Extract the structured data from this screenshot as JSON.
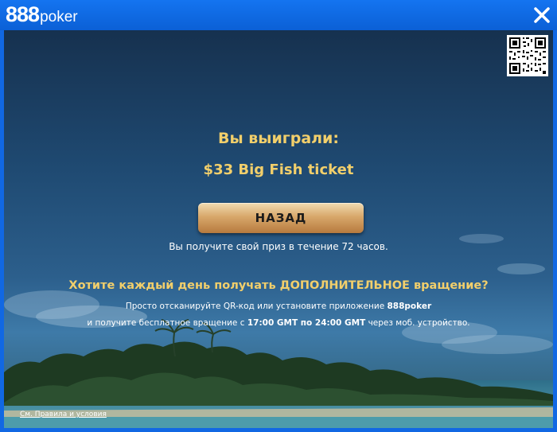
{
  "titlebar": {
    "logo_number": "888",
    "logo_word": "poker",
    "close_icon": "close-icon"
  },
  "colors": {
    "brand_blue": "#1168e3",
    "gold_text": "#f2cf6b",
    "button_gold": "#d8a86b"
  },
  "result": {
    "title": "Вы выиграли:",
    "prize": "$33 Big Fish ticket",
    "back_button": "НАЗАД",
    "note": "Вы получите свой приз в течение 72 часов."
  },
  "promo": {
    "question": "Хотите каждый день получать ДОПОЛНИТЕЛЬНОЕ вращение?",
    "line1_pre": "Просто отсканируйте QR-код или установите приложение ",
    "line1_app": "888poker",
    "line2_pre": "и получите бесплатное вращение с ",
    "line2_from": "17:00 GMT",
    "line2_mid": " по ",
    "line2_to": "24:00 GMT",
    "line2_post": " через моб. устройство."
  },
  "footer": {
    "terms_link": "См. Правила и условия"
  }
}
